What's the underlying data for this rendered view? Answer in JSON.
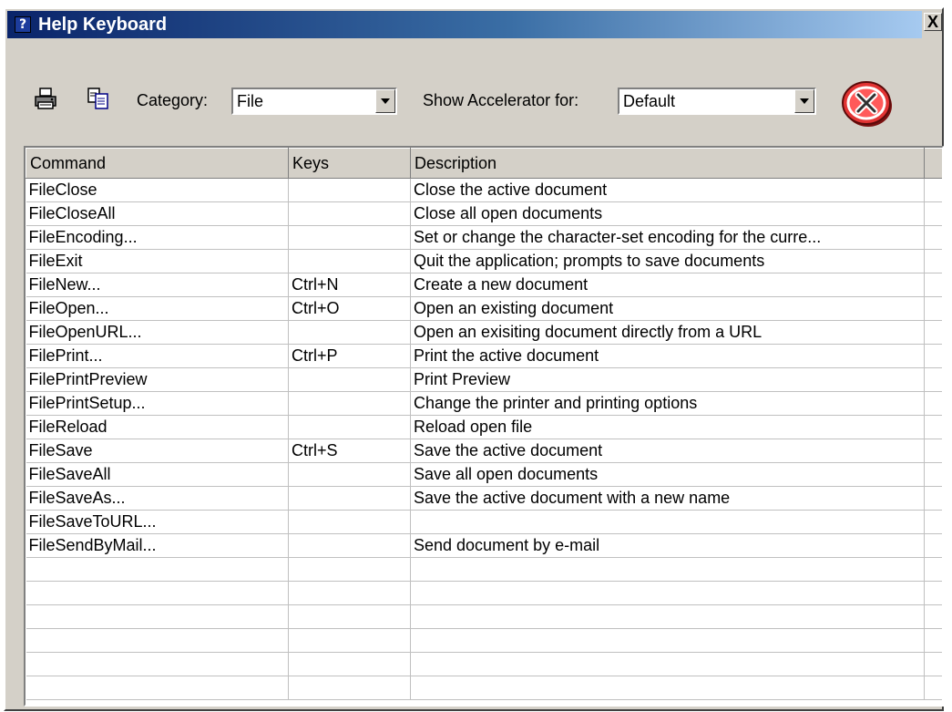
{
  "window": {
    "title": "Help Keyboard",
    "title_icon": "?",
    "close_label": "X"
  },
  "toolbar": {
    "print_icon": "printer-icon",
    "copy_icon": "copy-icon",
    "category_label": "Category:",
    "category_value": "File",
    "accelerator_label": "Show Accelerator for:",
    "accelerator_value": "Default",
    "stop_icon": "red-close-icon"
  },
  "table": {
    "columns": [
      "Command",
      "Keys",
      "Description"
    ],
    "rows": [
      [
        "FileClose",
        "",
        "Close the active document"
      ],
      [
        "FileCloseAll",
        "",
        "Close all open documents"
      ],
      [
        "FileEncoding...",
        "",
        "Set or change the character-set encoding for the curre..."
      ],
      [
        "FileExit",
        "",
        "Quit the application; prompts to save documents"
      ],
      [
        "FileNew...",
        "Ctrl+N",
        "Create a new document"
      ],
      [
        "FileOpen...",
        "Ctrl+O",
        "Open an existing document"
      ],
      [
        "FileOpenURL...",
        "",
        "Open an exisiting document directly from a URL"
      ],
      [
        "FilePrint...",
        "Ctrl+P",
        "Print the active document"
      ],
      [
        "FilePrintPreview",
        "",
        "Print Preview"
      ],
      [
        "FilePrintSetup...",
        "",
        "Change the printer and printing options"
      ],
      [
        "FileReload",
        "",
        "Reload open file"
      ],
      [
        "FileSave",
        "Ctrl+S",
        "Save the active document"
      ],
      [
        "FileSaveAll",
        "",
        "Save all open documents"
      ],
      [
        "FileSaveAs...",
        "",
        "Save the active document with a new name"
      ],
      [
        "FileSaveToURL...",
        "",
        ""
      ],
      [
        "FileSendByMail...",
        "",
        "Send document by e-mail"
      ],
      [
        "",
        "",
        ""
      ],
      [
        "",
        "",
        ""
      ],
      [
        "",
        "",
        ""
      ],
      [
        "",
        "",
        ""
      ],
      [
        "",
        "",
        ""
      ],
      [
        "",
        "",
        ""
      ]
    ]
  }
}
